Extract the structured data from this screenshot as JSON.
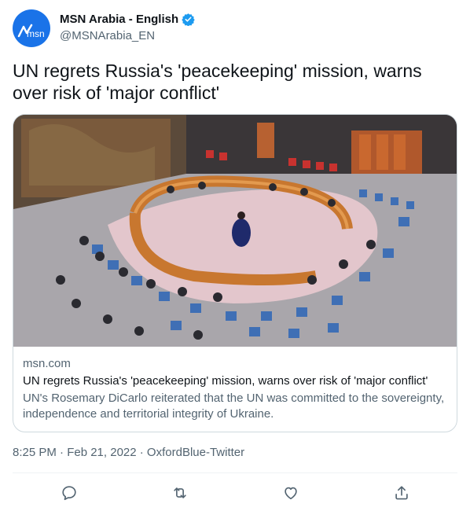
{
  "account": {
    "display_name": "MSN Arabia - English",
    "handle": "@MSNArabia_EN",
    "avatar_text": "msn",
    "verified_icon": "verified-badge-icon"
  },
  "tweet": {
    "text": "UN regrets Russia's 'peacekeeping' mission, warns over risk of 'major conflict'"
  },
  "card": {
    "image_alt": "UN Security Council chamber with horseshoe table",
    "domain": "msn.com",
    "title": "UN regrets Russia's 'peacekeeping' mission, warns over risk of 'major conflict'",
    "description": "UN's Rosemary DiCarlo reiterated that the UN was committed to the sovereignty, independence and territorial integrity of Ukraine."
  },
  "meta": {
    "timestamp": "8:25 PM · Feb 21, 2022 · OxfordBlue-Twitter"
  },
  "actions": [
    "reply-icon",
    "retweet-icon",
    "like-icon",
    "share-icon"
  ],
  "colors": {
    "accent": "#1d9bf0",
    "secondary_text": "#536471",
    "border": "#cfd9de",
    "avatar_bg": "#1a73e8"
  }
}
